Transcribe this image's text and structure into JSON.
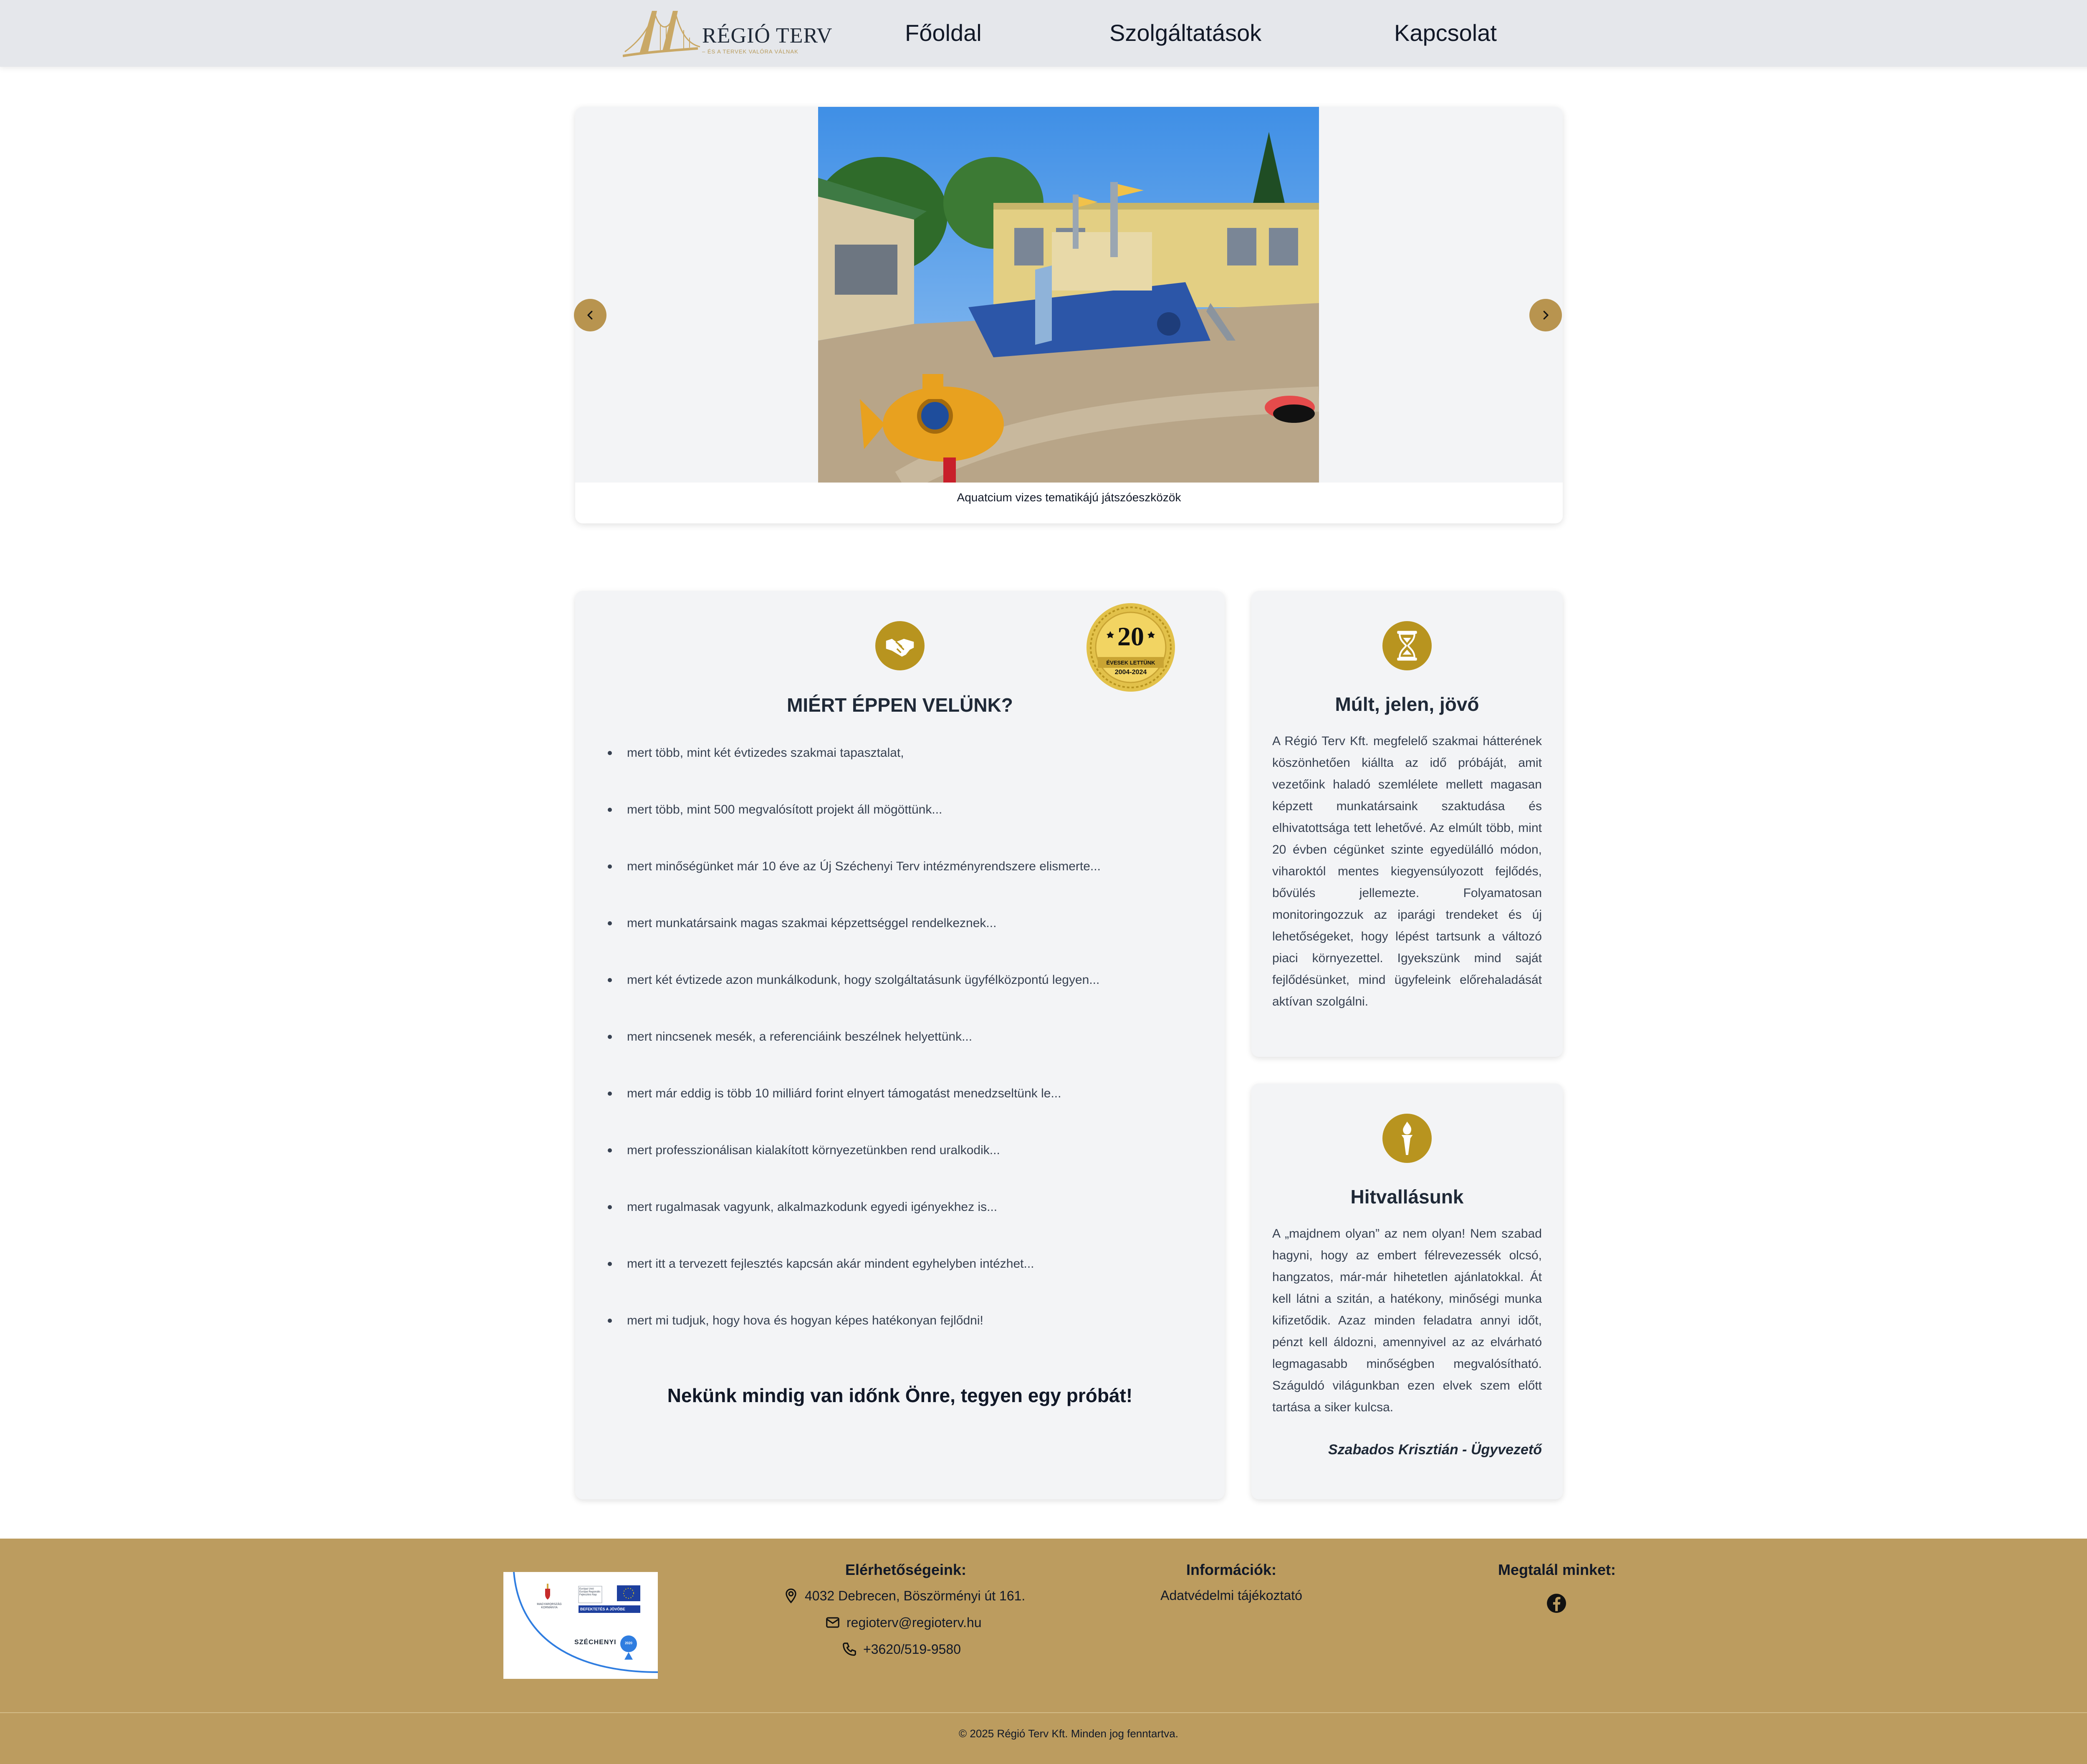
{
  "brand": {
    "logo_name": "RÉGIÓ TERV",
    "logo_tagline": "– ÉS A TERVEK VALÓRA VÁLNAK"
  },
  "nav": {
    "items": [
      "Főoldal",
      "Szolgáltatások",
      "Kapcsolat"
    ]
  },
  "carousel": {
    "caption": "Aquatcium vizes tematikájú játszóeszközök",
    "prev_icon": "chevron-left-icon",
    "next_icon": "chevron-right-icon"
  },
  "why": {
    "icon": "handshake-icon",
    "title": "MIÉRT ÉPPEN VELÜNK?",
    "badge": {
      "number": "20",
      "line1": "ÉVESEK LETTÜNK",
      "line2": "2004-2024"
    },
    "items": [
      "mert több, mint két évtizedes szakmai tapasztalat,",
      "mert több, mint 500 megvalósított projekt áll mögöttünk...",
      "mert minőségünket már 10 éve az Új Széchenyi Terv intézményrendszere elismerte...",
      "mert munkatársaink magas szakmai képzettséggel rendelkeznek...",
      "mert két évtizede azon munkálkodunk, hogy szolgáltatásunk ügyfélközpontú legyen...",
      "mert nincsenek mesék, a referenciáink beszélnek helyettünk...",
      "mert már eddig is több 10 milliárd forint elnyert támogatást menedzseltünk le...",
      "mert professzionálisan kialakított környezetünkben rend uralkodik...",
      "mert rugalmasak vagyunk, alkalmazkodunk egyedi igényekhez is...",
      "mert itt a tervezett fejlesztés kapcsán akár mindent egyhelyben intézhet...",
      "mert mi tudjuk, hogy hova és hogyan képes hatékonyan fejlődni!"
    ],
    "footer": "Nekünk mindig van időnk Önre, tegyen egy próbát!"
  },
  "past": {
    "icon": "hourglass-icon",
    "title": "Múlt, jelen, jövő",
    "text": "A Régió Terv Kft. megfelelő szakmai hátterének köszönhetően kiállta az idő próbáját, amit vezetőink haladó szemlélete mellett magasan képzett munkatársaink szaktudása és elhivatottsága tett lehetővé. Az elmúlt több, mint 20 évben cégünket szinte egyedülálló módon, viharoktól mentes kiegyensúlyozott fejlődés, bővülés jellemezte. Folyamatosan monitoringozzuk az iparági trendeket és új lehetőségeket, hogy lépést tartsunk a változó piaci környezettel. Igyekszünk mind saját fejlődésünket, mind ügyfeleink előrehaladását aktívan szolgálni."
  },
  "creed": {
    "icon": "torch-icon",
    "title": "Hitvallásunk",
    "text": "A „majdnem olyan” az nem olyan! Nem szabad hagyni, hogy az embert félrevezessék olcsó, hangzatos, már-már hihetetlen ajánlatokkal. Át kell látni a szitán, a hatékony, minőségi munka kifizetődik. Azaz minden feladatra annyi időt, pénzt kell áldozni, amennyivel az az elvárható legmagasabb minőségben megvalósítható. Száguldó világunkban ezen elvek szem előtt tartása a siker kulcsa.",
    "signature": "Szabados Krisztián - Ügyvezető"
  },
  "footer": {
    "eu_logo": {
      "hu_gov": "MAGYARORSZÁG KORMÁNYA",
      "eu_text": "Európai Unió Európai Regionális Fejlesztési Alap",
      "eu_slogan": "BEFEKTETÉS A JÖVŐBE",
      "szechenyi": "SZÉCHENYI",
      "badge": "2020"
    },
    "contact": {
      "heading": "Elérhetőségeink:",
      "address": "4032 Debrecen, Böszörményi út 161.",
      "email": "regioterv@regioterv.hu",
      "phone": "+3620/519-9580",
      "address_icon": "map-pin-icon",
      "email_icon": "mail-icon",
      "phone_icon": "phone-icon"
    },
    "info": {
      "heading": "Információk:",
      "link": "Adatvédelmi tájékoztató"
    },
    "social": {
      "heading": "Megtalál minket:",
      "icon": "facebook-icon"
    },
    "copyright": "© 2025 Régió Terv Kft. Minden jog fenntartva."
  },
  "colors": {
    "accent": "#bc9c5f",
    "icon_gold": "#b8941f",
    "nav_bg": "#e5e7eb",
    "card_bg": "#f3f4f6"
  }
}
